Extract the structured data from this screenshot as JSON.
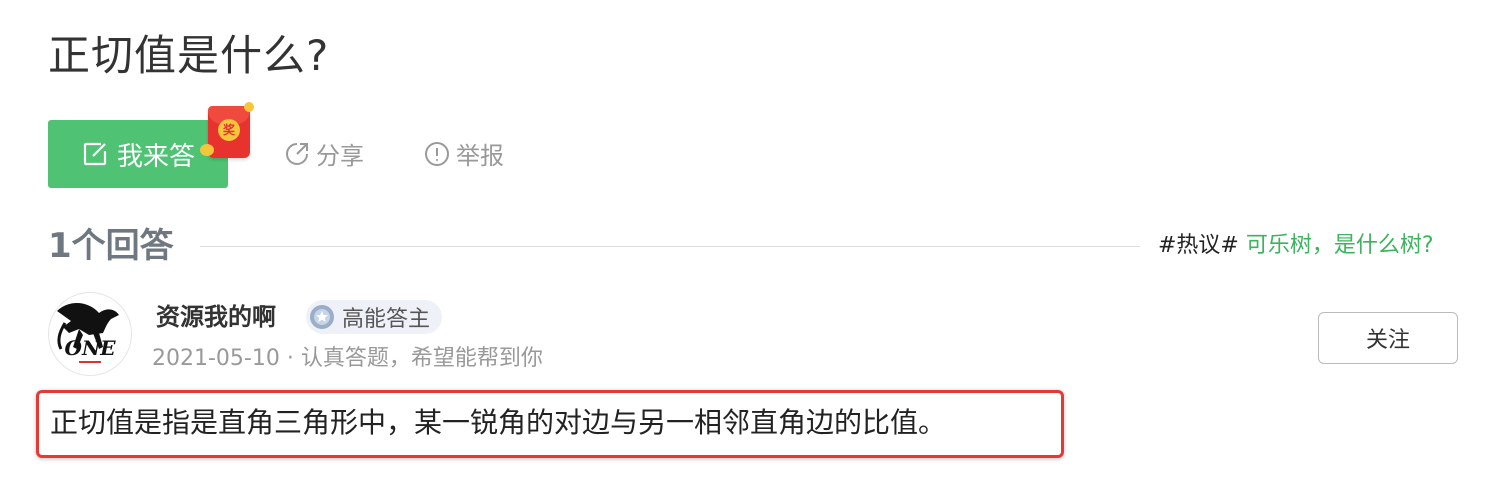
{
  "question": {
    "title": "正切值是什么?"
  },
  "actions": {
    "answer_label": "我来答",
    "reward_char": "奖",
    "share_label": "分享",
    "report_label": "举报"
  },
  "answers": {
    "count_label": "1个回答",
    "hot_tag": "#热议#",
    "hot_link": "可乐树，是什么树?"
  },
  "answer": {
    "author": "资源我的啊",
    "badge": "高能答主",
    "meta": "2021-05-10 · 认真答题，希望能帮到你",
    "follow_label": "关注",
    "avatar_text": "ONE",
    "text": "正切值是指是直角三角形中，某一锐角的对边与另一相邻直角边的比值。"
  },
  "colors": {
    "primary_green": "#4fc373",
    "link_green": "#3cb35d",
    "highlight_red": "#e53935"
  }
}
